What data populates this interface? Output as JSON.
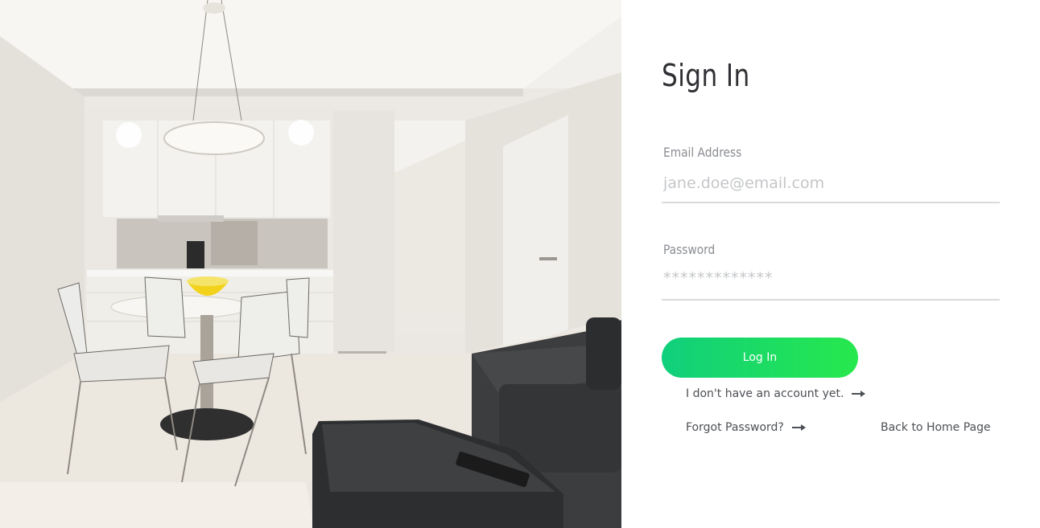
{
  "signin": {
    "title": "Sign In",
    "email": {
      "label": "Email Address",
      "placeholder": "jane.doe@email.com",
      "value": ""
    },
    "password": {
      "label": "Password",
      "placeholder": "*************",
      "value": ""
    },
    "login_button": "Log In",
    "no_account_link": "I don't have an account yet.",
    "forgot_link": "Forgot Password?",
    "back_home_link": "Back to Home Page",
    "colors": {
      "button_start": "#10cf7c",
      "button_end": "#27e84d",
      "title": "#2f3033",
      "label": "#8a8d92",
      "placeholder": "#c4c6c9",
      "underline": "#d9dadc"
    }
  },
  "icons": {
    "no_account_arrow": "arrow-right-icon",
    "forgot_arrow": "arrow-right-icon"
  }
}
